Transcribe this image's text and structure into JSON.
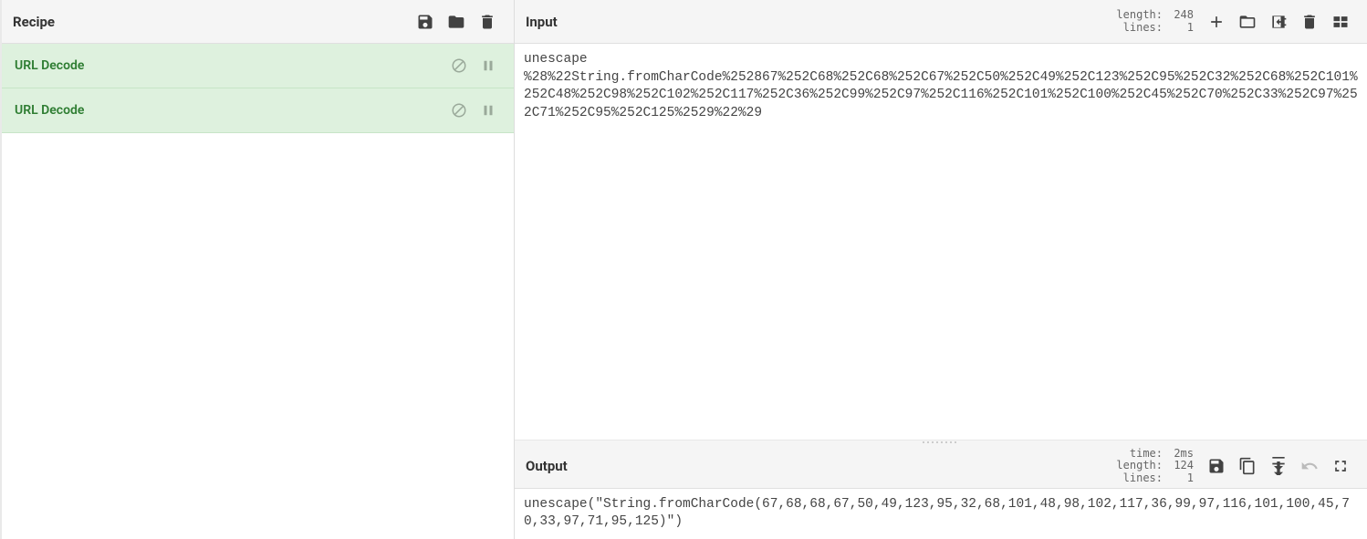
{
  "recipe": {
    "title": "Recipe",
    "operations": [
      {
        "name": "URL Decode"
      },
      {
        "name": "URL Decode"
      }
    ]
  },
  "input": {
    "title": "Input",
    "stats": {
      "length_label": "length:",
      "length_value": "248",
      "lines_label": "lines:",
      "lines_value": "1"
    },
    "content": "unescape\n%28%22String.fromCharCode%252867%252C68%252C68%252C67%252C50%252C49%252C123%252C95%252C32%252C68%252C101%252C48%252C98%252C102%252C117%252C36%252C99%252C97%252C116%252C101%252C100%252C45%252C70%252C33%252C97%252C71%252C95%252C125%2529%22%29"
  },
  "output": {
    "title": "Output",
    "stats": {
      "time_label": "time:",
      "time_value": "2ms",
      "length_label": "length:",
      "length_value": "124",
      "lines_label": "lines:",
      "lines_value": "1"
    },
    "content": "unescape(\"String.fromCharCode(67,68,68,67,50,49,123,95,32,68,101,48,98,102,117,36,99,97,116,101,100,45,70,33,97,71,95,125)\")"
  }
}
